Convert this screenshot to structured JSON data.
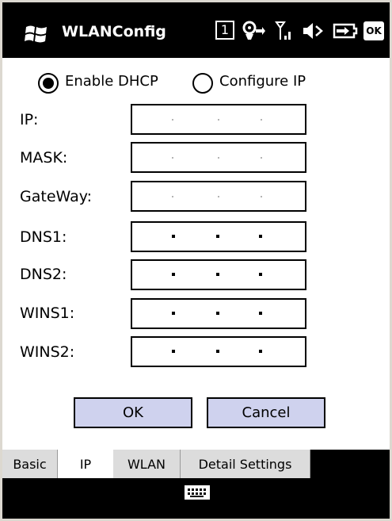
{
  "titlebar": {
    "app_title": "WLANConfig",
    "icons": [
      "windows-flag-icon",
      "one-icon",
      "connectivity-icon",
      "signal-icon",
      "volume-muted-icon",
      "battery-charging-icon",
      "ok-icon"
    ],
    "one_label": "1",
    "ok_label": "OK"
  },
  "ip_mode": {
    "dhcp_label": "Enable DHCP",
    "static_label": "Configure IP",
    "selected": "Enable DHCP"
  },
  "fields": [
    {
      "label": "IP:",
      "enabled": false
    },
    {
      "label": "MASK:",
      "enabled": false
    },
    {
      "label": "GateWay:",
      "enabled": false
    },
    {
      "label": "DNS1:",
      "enabled": true
    },
    {
      "label": "DNS2:",
      "enabled": true
    },
    {
      "label": "WINS1:",
      "enabled": true
    },
    {
      "label": "WINS2:",
      "enabled": true
    }
  ],
  "buttons": {
    "ok": "OK",
    "cancel": "Cancel"
  },
  "tabs": [
    {
      "label": "Basic",
      "selected": false
    },
    {
      "label": "IP",
      "selected": true
    },
    {
      "label": "WLAN",
      "selected": false
    },
    {
      "label": "Detail Settings",
      "selected": false
    }
  ],
  "colors": {
    "bar": "#000000",
    "button_bg": "#cfd2ee",
    "tab_bg": "#dcdcdc",
    "disabled_dot": "#b4b4b4"
  }
}
